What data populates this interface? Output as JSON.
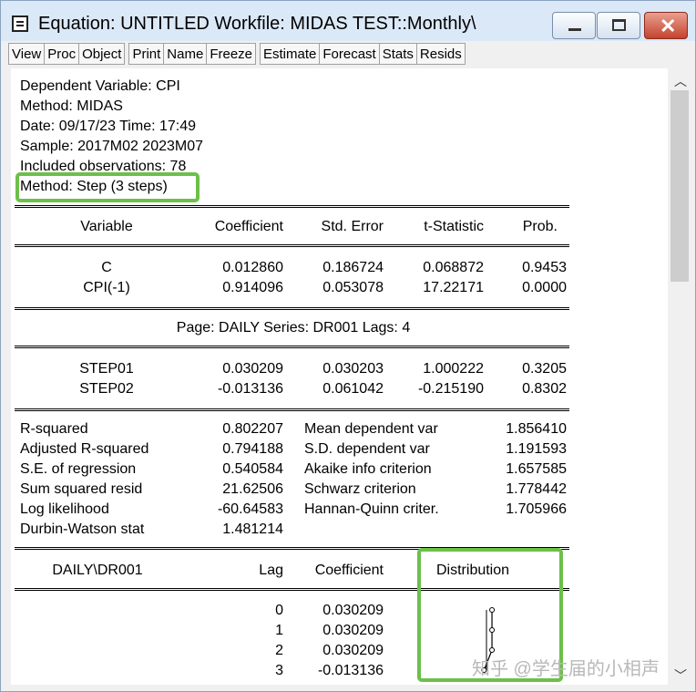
{
  "window": {
    "title": "Equation: UNTITLED   Workfile: MIDAS TEST::Monthly\\",
    "controls": {
      "minimize": "minimize-icon",
      "maximize": "maximize-icon",
      "close": "close-icon"
    }
  },
  "toolbar": [
    "View",
    "Proc",
    "Object",
    "Print",
    "Name",
    "Freeze",
    "Estimate",
    "Forecast",
    "Stats",
    "Resids"
  ],
  "header_lines": [
    "Dependent Variable: CPI",
    "Method: MIDAS",
    "Date: 09/17/23   Time: 17:49",
    "Sample: 2017M02 2023M07",
    "Included observations: 78",
    "Method: Step (3 steps)"
  ],
  "coef_table": {
    "columns": [
      "Variable",
      "Coefficient",
      "Std. Error",
      "t-Statistic",
      "Prob."
    ],
    "rows": [
      [
        "C",
        "0.012860",
        "0.186724",
        "0.068872",
        "0.9453"
      ],
      [
        "CPI(-1)",
        "0.914096",
        "0.053078",
        "17.22171",
        "0.0000"
      ]
    ],
    "midas_header": "Page: DAILY   Series: DR001   Lags: 4",
    "midas_rows": [
      [
        "STEP01",
        "0.030209",
        "0.030203",
        "1.000222",
        "0.3205"
      ],
      [
        "STEP02",
        "-0.013136",
        "0.061042",
        "-0.215190",
        "0.8302"
      ]
    ]
  },
  "stats": {
    "left": [
      [
        "R-squared",
        "0.802207"
      ],
      [
        "Adjusted R-squared",
        "0.794188"
      ],
      [
        "S.E. of regression",
        "0.540584"
      ],
      [
        "Sum squared resid",
        "21.62506"
      ],
      [
        "Log likelihood",
        "-60.64583"
      ],
      [
        "Durbin-Watson stat",
        "1.481214"
      ]
    ],
    "right": [
      [
        "Mean dependent var",
        "1.856410"
      ],
      [
        "S.D. dependent var",
        "1.191593"
      ],
      [
        "Akaike info criterion",
        "1.657585"
      ],
      [
        "Schwarz criterion",
        "1.778442"
      ],
      [
        "Hannan-Quinn criter.",
        "1.705966"
      ]
    ]
  },
  "lag_table": {
    "columns": [
      "DAILY\\DR001",
      "Lag",
      "Coefficient",
      "Distribution"
    ],
    "rows": [
      [
        "0",
        "0.030209"
      ],
      [
        "1",
        "0.030209"
      ],
      [
        "2",
        "0.030209"
      ],
      [
        "3",
        "-0.013136"
      ]
    ],
    "distribution_values": [
      0.030209,
      0.030209,
      0.030209,
      -0.013136
    ]
  },
  "highlight_color": "#6cc04a",
  "watermark": "知乎 @学生届的小相声"
}
